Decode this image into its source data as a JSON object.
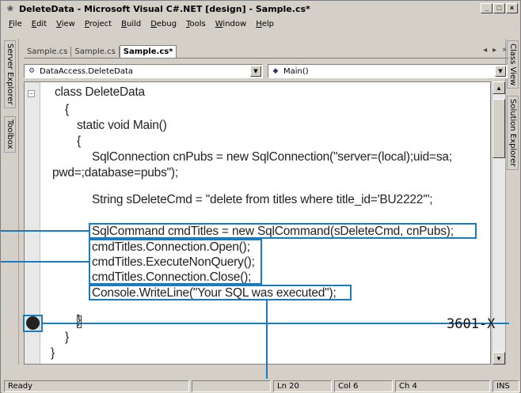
{
  "window": {
    "title": "DeleteData - Microsoft Visual C#.NET [design] - Sample.cs*",
    "app_icon": "vs-net-icon",
    "buttons": [
      "_",
      "□",
      "×"
    ]
  },
  "menubar": {
    "items": [
      "File",
      "Edit",
      "View",
      "Project",
      "Build",
      "Debug",
      "Tools",
      "Window",
      "Help"
    ]
  },
  "left_panels": [
    "Server Explorer",
    "Toolbox"
  ],
  "right_panels": [
    "Class View",
    "Solution Explorer"
  ],
  "doc_tabs": [
    {
      "label": "Sample.cs",
      "active": false
    },
    {
      "label": "Sample.cs",
      "active": false
    },
    {
      "label": "Sample.cs*",
      "active": true
    }
  ],
  "tab_nav": {
    "left": "◂",
    "right": "▸",
    "close": "×"
  },
  "combos": {
    "class_selector": "DataAccess.DeleteData",
    "member_selector": "Main()"
  },
  "code_lines": [
    "class DeleteData",
    "{",
    "static void Main()",
    "{",
    "SqlConnection cnPubs = new SqlConnection(\"server=(local);uid=sa;",
    "pwd=;database=pubs\");",
    "String sDeleteCmd = \"delete from titles where title_id='BU2222'\";",
    "SqlCommand cmdTitles = new SqlCommand(sDeleteCmd, cnPubs);",
    "cmdTitles.Connection.Open();",
    "cmdTitles.ExecuteNonQuery();",
    "cmdTitles.Connection.Close();",
    "Console.WriteLine(\"Your SQL was executed\");",
    "}",
    "}",
    "}"
  ],
  "figure_label": "3601-X",
  "statusbar": {
    "status": "Ready",
    "line": "Ln 20",
    "col": "Col 6",
    "ch": "Ch 4",
    "mode": "INS"
  },
  "colors": {
    "callout": "#1a7bbf",
    "chrome": "#d4d0c8"
  }
}
